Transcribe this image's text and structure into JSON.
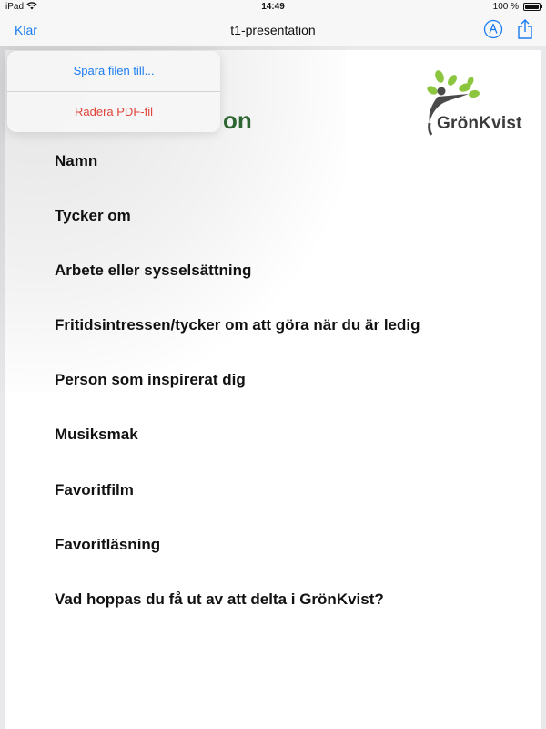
{
  "status_bar": {
    "device": "iPad",
    "time": "14:49",
    "battery_percent": "100 %",
    "battery_level": 1.0
  },
  "nav_bar": {
    "done_label": "Klar",
    "title": "t1-presentation",
    "markup_icon": "pen-circle-icon",
    "share_icon": "share-icon"
  },
  "document": {
    "heading_visible_fragment": "on",
    "logo_text": "GrönKvist",
    "questions": [
      "Namn",
      "Tycker om",
      "Arbete eller sysselsättning",
      "Fritidsintressen/tycker om att göra när du är ledig",
      "Person som inspirerat dig",
      "Musiksmak",
      "Favoritfilm",
      "Favoritläsning",
      "Vad hoppas du få ut av att delta i GrönKvist?"
    ]
  },
  "popup_menu": {
    "items": [
      {
        "label": "Spara filen till...",
        "color": "#1b7cf0"
      },
      {
        "label": "Radera PDF-fil",
        "color": "#e0453a"
      }
    ]
  },
  "colors": {
    "accent": "#1b7cf0",
    "destructive": "#e0453a",
    "heading_green": "#2f6b34",
    "leaf_green": "#8cc63f"
  }
}
